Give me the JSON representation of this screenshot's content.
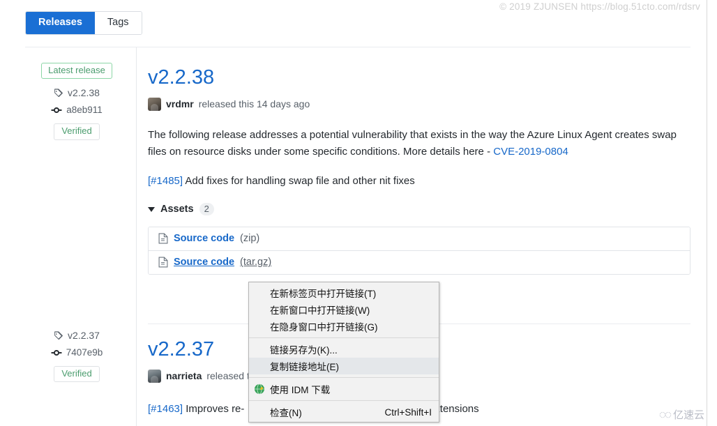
{
  "watermarks": {
    "top_right": "© 2019 ZJUNSEN https://blog.51cto.com/rdsrv",
    "bottom_right": "亿速云"
  },
  "tabs": [
    {
      "label": "Releases",
      "active": true
    },
    {
      "label": "Tags",
      "active": false
    }
  ],
  "releases": [
    {
      "meta": {
        "latest_badge": "Latest release",
        "tag": "v2.2.38",
        "commit": "a8eb911",
        "verified_badge": "Verified"
      },
      "title": "v2.2.38",
      "author": "vrdmr",
      "byline_suffix": "released this 14 days ago",
      "body_line_1": "The following release addresses a potential vulnerability that exists in the way the Azure Linux Agent creates swap files on resource disks under some specific conditions. More details here - ",
      "cve_link": "CVE-2019-0804",
      "issue_link": "[#1485]",
      "issue_text": " Add fixes for handling swap file and other nit fixes",
      "assets": {
        "label": "Assets",
        "count": "2",
        "rows": [
          {
            "name": "Source code",
            "ext": "(zip)",
            "hovered": false
          },
          {
            "name": "Source code",
            "ext": "(tar.gz)",
            "hovered": true
          }
        ]
      }
    },
    {
      "meta": {
        "tag": "v2.2.37",
        "commit": "7407e9b",
        "verified_badge": "Verified"
      },
      "title": "v2.2.37",
      "author": "narrieta",
      "byline_suffix": "released thi",
      "issue_link": "[#1463]",
      "issue_text": " Improves re-",
      "issue_text_tail": "ding extensions"
    }
  ],
  "context_menu": {
    "items": [
      {
        "label": "在新标签页中打开链接(T)",
        "accel": "",
        "highlight": false,
        "icon": "",
        "separator_after": false
      },
      {
        "label": "在新窗口中打开链接(W)",
        "accel": "",
        "highlight": false,
        "icon": "",
        "separator_after": false
      },
      {
        "label": "在隐身窗口中打开链接(G)",
        "accel": "",
        "highlight": false,
        "icon": "",
        "separator_after": true
      },
      {
        "label": "链接另存为(K)...",
        "accel": "",
        "highlight": false,
        "icon": "",
        "separator_after": false
      },
      {
        "label": "复制链接地址(E)",
        "accel": "",
        "highlight": true,
        "icon": "",
        "separator_after": true
      },
      {
        "label": "使用 IDM 下载",
        "accel": "",
        "highlight": false,
        "icon": "idm-icon",
        "separator_after": true
      },
      {
        "label": "检查(N)",
        "accel": "Ctrl+Shift+I",
        "highlight": false,
        "icon": "",
        "separator_after": false
      }
    ]
  },
  "colors": {
    "accent_blue": "#1a6fd4",
    "link_blue": "#1768c9",
    "verified_green": "#4a9c6d",
    "latest_border_green": "#8cd6a6",
    "menu_bg": "#f2f2f2",
    "menu_highlight": "#e4e7ea"
  }
}
